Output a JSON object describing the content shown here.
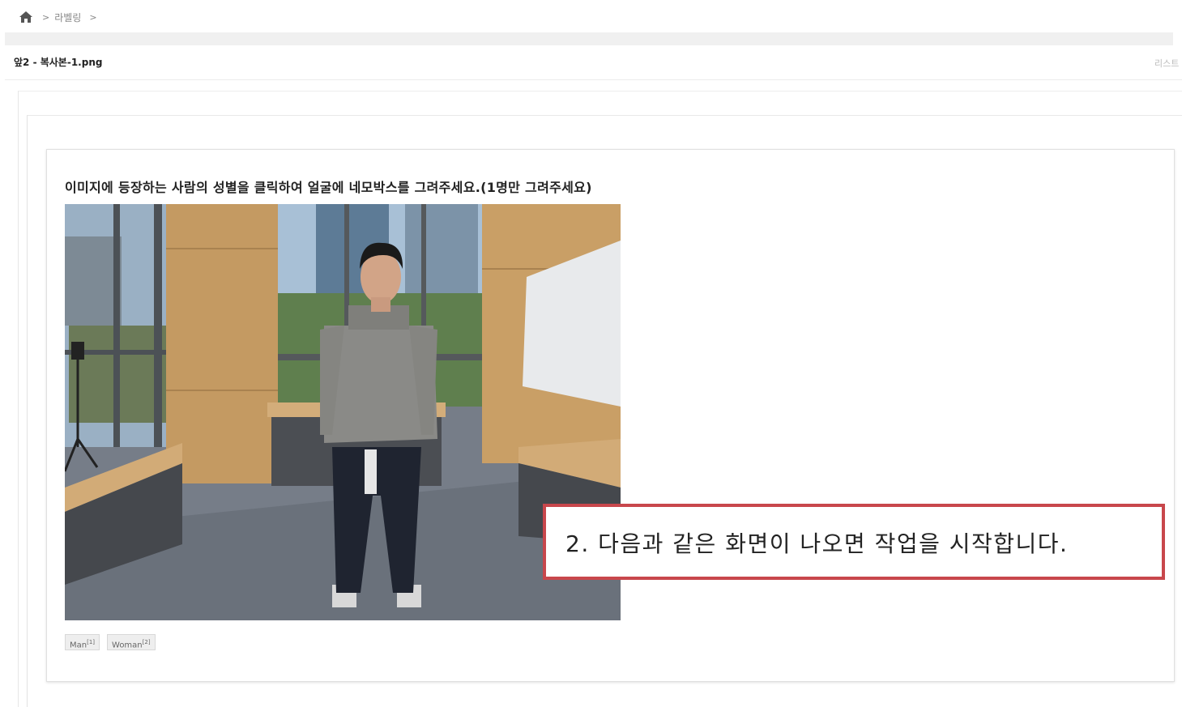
{
  "breadcrumb": {
    "home_icon": "home-icon",
    "separator": ">",
    "item": "라벨링"
  },
  "header": {
    "file_title": "앞2 - 복사본-1.png",
    "list_link": "리스트"
  },
  "task": {
    "instruction": "이미지에 등장하는 사람의 성별을 클릭하여 얼굴에 네모박스를 그려주세요.(1명만 그려주세요)",
    "labels": [
      {
        "text": "Man",
        "shortcut": "[1]"
      },
      {
        "text": "Woman",
        "shortcut": "[2]"
      }
    ]
  },
  "callout": {
    "text": "2. 다음과 같은 화면이 나오면 작업을 시작합니다.",
    "border_color": "#c8474c"
  }
}
